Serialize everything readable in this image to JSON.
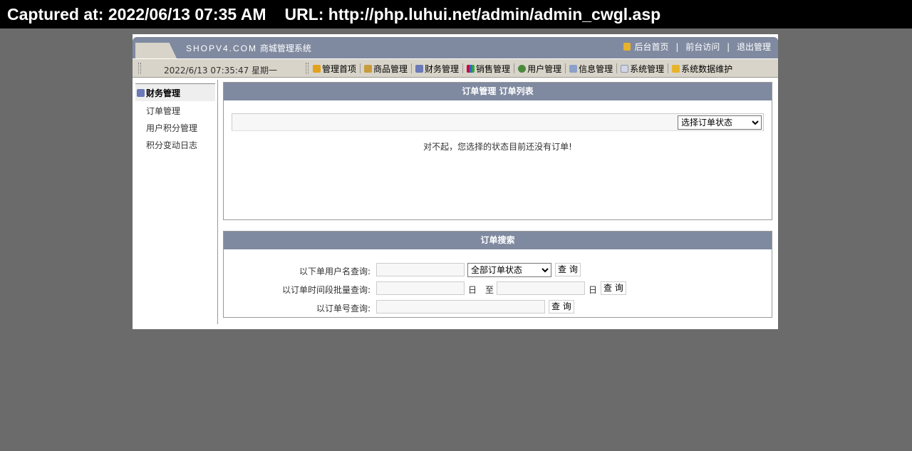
{
  "capture": {
    "captured": "Captured at: 2022/06/13 07:35 AM",
    "url": "URL: http://php.luhui.net/admin/admin_cwgl.asp"
  },
  "header": {
    "logo": "SHOPV4.COM",
    "system_name": "商城管理系统",
    "links": [
      "后台首页",
      "前台访问",
      "退出管理"
    ],
    "separator": "|"
  },
  "toolbar": {
    "datetime": "2022/6/13 07:35:47 星期一",
    "nav": [
      "管理首项",
      "商品管理",
      "财务管理",
      "销售管理",
      "用户管理",
      "信息管理",
      "系统管理",
      "系统数据维护"
    ]
  },
  "sidebar": {
    "heading": "财务管理",
    "items": [
      "订单管理",
      "用户积分管理",
      "积分变动日志"
    ]
  },
  "order_list": {
    "title": "订单管理 订单列表",
    "status_select": "选择订单状态",
    "empty_message": "对不起，您选择的状态目前还没有订单!"
  },
  "order_search": {
    "title": "订单搜索",
    "by_user_label": "以下单用户名查询:",
    "status_select": "全部订单状态",
    "query_button": "查 询",
    "by_date_label": "以订单时间段批量查询:",
    "day_label": "日",
    "to_label": "至",
    "by_order_no_label": "以订单号查询:"
  }
}
